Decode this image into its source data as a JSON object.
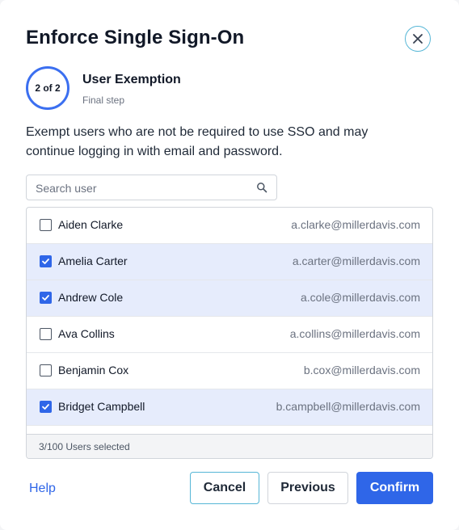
{
  "dialog": {
    "title": "Enforce Single Sign-On",
    "step": {
      "badge": "2 of 2",
      "title": "User Exemption",
      "subtitle": "Final step"
    },
    "description": "Exempt users who are not be required to use SSO and may continue logging in with email and password."
  },
  "search": {
    "placeholder": "Search user",
    "value": ""
  },
  "users": [
    {
      "name": "Aiden Clarke",
      "email": "a.clarke@millerdavis.com",
      "selected": false
    },
    {
      "name": "Amelia Carter",
      "email": "a.carter@millerdavis.com",
      "selected": true
    },
    {
      "name": "Andrew Cole",
      "email": "a.cole@millerdavis.com",
      "selected": true
    },
    {
      "name": "Ava Collins",
      "email": "a.collins@millerdavis.com",
      "selected": false
    },
    {
      "name": "Benjamin Cox",
      "email": "b.cox@millerdavis.com",
      "selected": false
    },
    {
      "name": "Bridget Campbell",
      "email": "b.campbell@millerdavis.com",
      "selected": true
    }
  ],
  "selection_status": "3/100 Users selected",
  "footer": {
    "help_label": "Help",
    "cancel_label": "Cancel",
    "previous_label": "Previous",
    "confirm_label": "Confirm"
  },
  "colors": {
    "accent": "#2f66e8",
    "selected_row": "#e6ecfc",
    "focus_outline": "#56b6d6"
  },
  "icons": {
    "close": "close-icon",
    "search": "search-icon",
    "checkbox": "checkmark-icon"
  }
}
